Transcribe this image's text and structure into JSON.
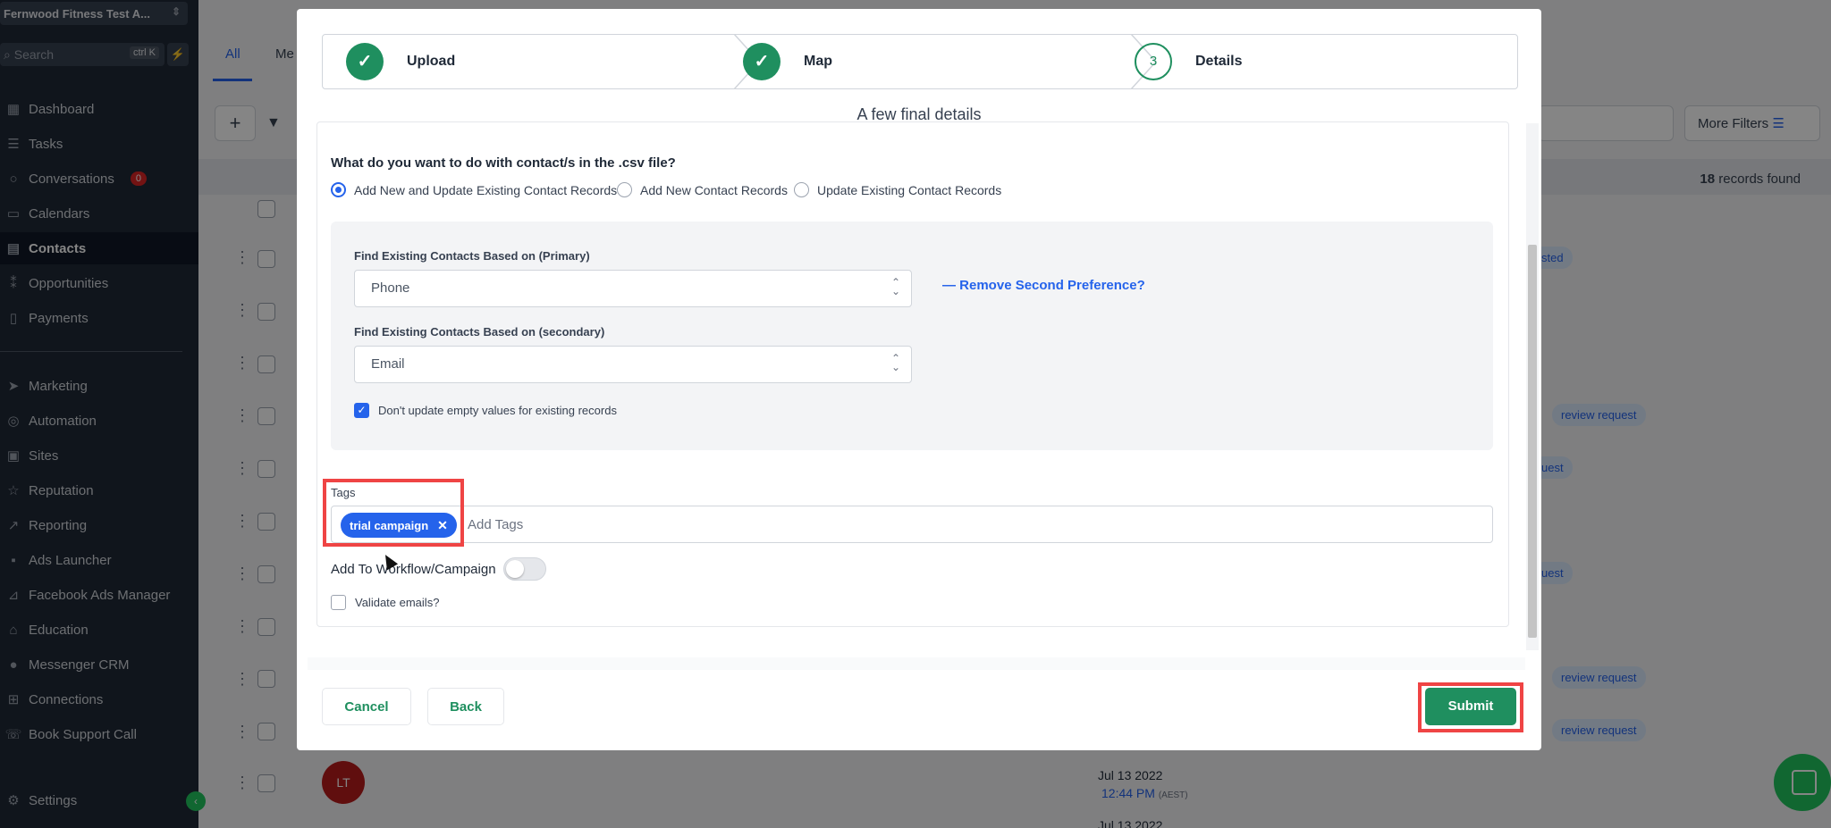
{
  "sidebar": {
    "account": "Fernwood Fitness Test A...",
    "search_placeholder": "Search",
    "search_shortcut": "ctrl K",
    "items": [
      {
        "label": "Dashboard",
        "icon": "dashboard-icon"
      },
      {
        "label": "Tasks",
        "icon": "tasks-icon"
      },
      {
        "label": "Conversations",
        "icon": "chat-icon",
        "badge": "0"
      },
      {
        "label": "Calendars",
        "icon": "calendar-icon"
      },
      {
        "label": "Contacts",
        "icon": "contacts-icon",
        "active": true
      },
      {
        "label": "Opportunities",
        "icon": "opportunities-icon"
      },
      {
        "label": "Payments",
        "icon": "payments-icon"
      },
      {
        "label": "Marketing",
        "icon": "marketing-icon"
      },
      {
        "label": "Automation",
        "icon": "automation-icon"
      },
      {
        "label": "Sites",
        "icon": "sites-icon"
      },
      {
        "label": "Reputation",
        "icon": "star-icon"
      },
      {
        "label": "Reporting",
        "icon": "reporting-icon"
      },
      {
        "label": "Ads Launcher",
        "icon": "ads-icon"
      },
      {
        "label": "Facebook Ads Manager",
        "icon": "chart-icon"
      },
      {
        "label": "Education",
        "icon": "education-icon"
      },
      {
        "label": "Messenger CRM",
        "icon": "messenger-icon"
      },
      {
        "label": "Connections",
        "icon": "connections-icon"
      },
      {
        "label": "Book Support Call",
        "icon": "phone-icon"
      },
      {
        "label": "Settings",
        "icon": "gear-icon"
      }
    ]
  },
  "background": {
    "tab_all": "All",
    "tab_partial": "Me",
    "more_filters": "More Filters",
    "records_count": "18",
    "records_suffix": " records found",
    "tags": [
      "sted",
      "review request",
      "uest",
      "uest",
      "review request",
      "review request"
    ],
    "avatar_initials": "LT",
    "date": "Jul 13 2022",
    "time": "12:44 PM",
    "timezone": "(AEST)",
    "date_partial": "Jul 13 2022"
  },
  "modal": {
    "steps": [
      {
        "label": "Upload",
        "state": "done"
      },
      {
        "label": "Map",
        "state": "done"
      },
      {
        "label": "Details",
        "state": "current",
        "number": "3"
      }
    ],
    "subtitle": "A few final details",
    "question": "What do you want to do with contact/s in the .csv file?",
    "options": [
      {
        "label": "Add New and Update Existing Contact Records",
        "selected": true
      },
      {
        "label": "Add New Contact Records",
        "selected": false
      },
      {
        "label": "Update Existing Contact Records",
        "selected": false
      }
    ],
    "primary_label": "Find Existing Contacts Based on (Primary)",
    "primary_value": "Phone",
    "remove_pref": "Remove Second Preference?",
    "secondary_label": "Find Existing Contacts Based on (secondary)",
    "secondary_value": "Email",
    "dont_update_label": "Don't update empty values for existing records",
    "dont_update_checked": true,
    "tags_label": "Tags",
    "tag_chip": "trial campaign",
    "tags_placeholder": "Add Tags",
    "workflow_label": "Add To Workflow/Campaign",
    "workflow_enabled": false,
    "validate_label": "Validate emails?",
    "validate_checked": false,
    "cancel": "Cancel",
    "back": "Back",
    "submit": "Submit"
  },
  "colors": {
    "primary_green": "#1f8f5f",
    "link_blue": "#2563eb",
    "highlight_red": "#ef4444",
    "sidebar_bg": "#1f2937"
  }
}
